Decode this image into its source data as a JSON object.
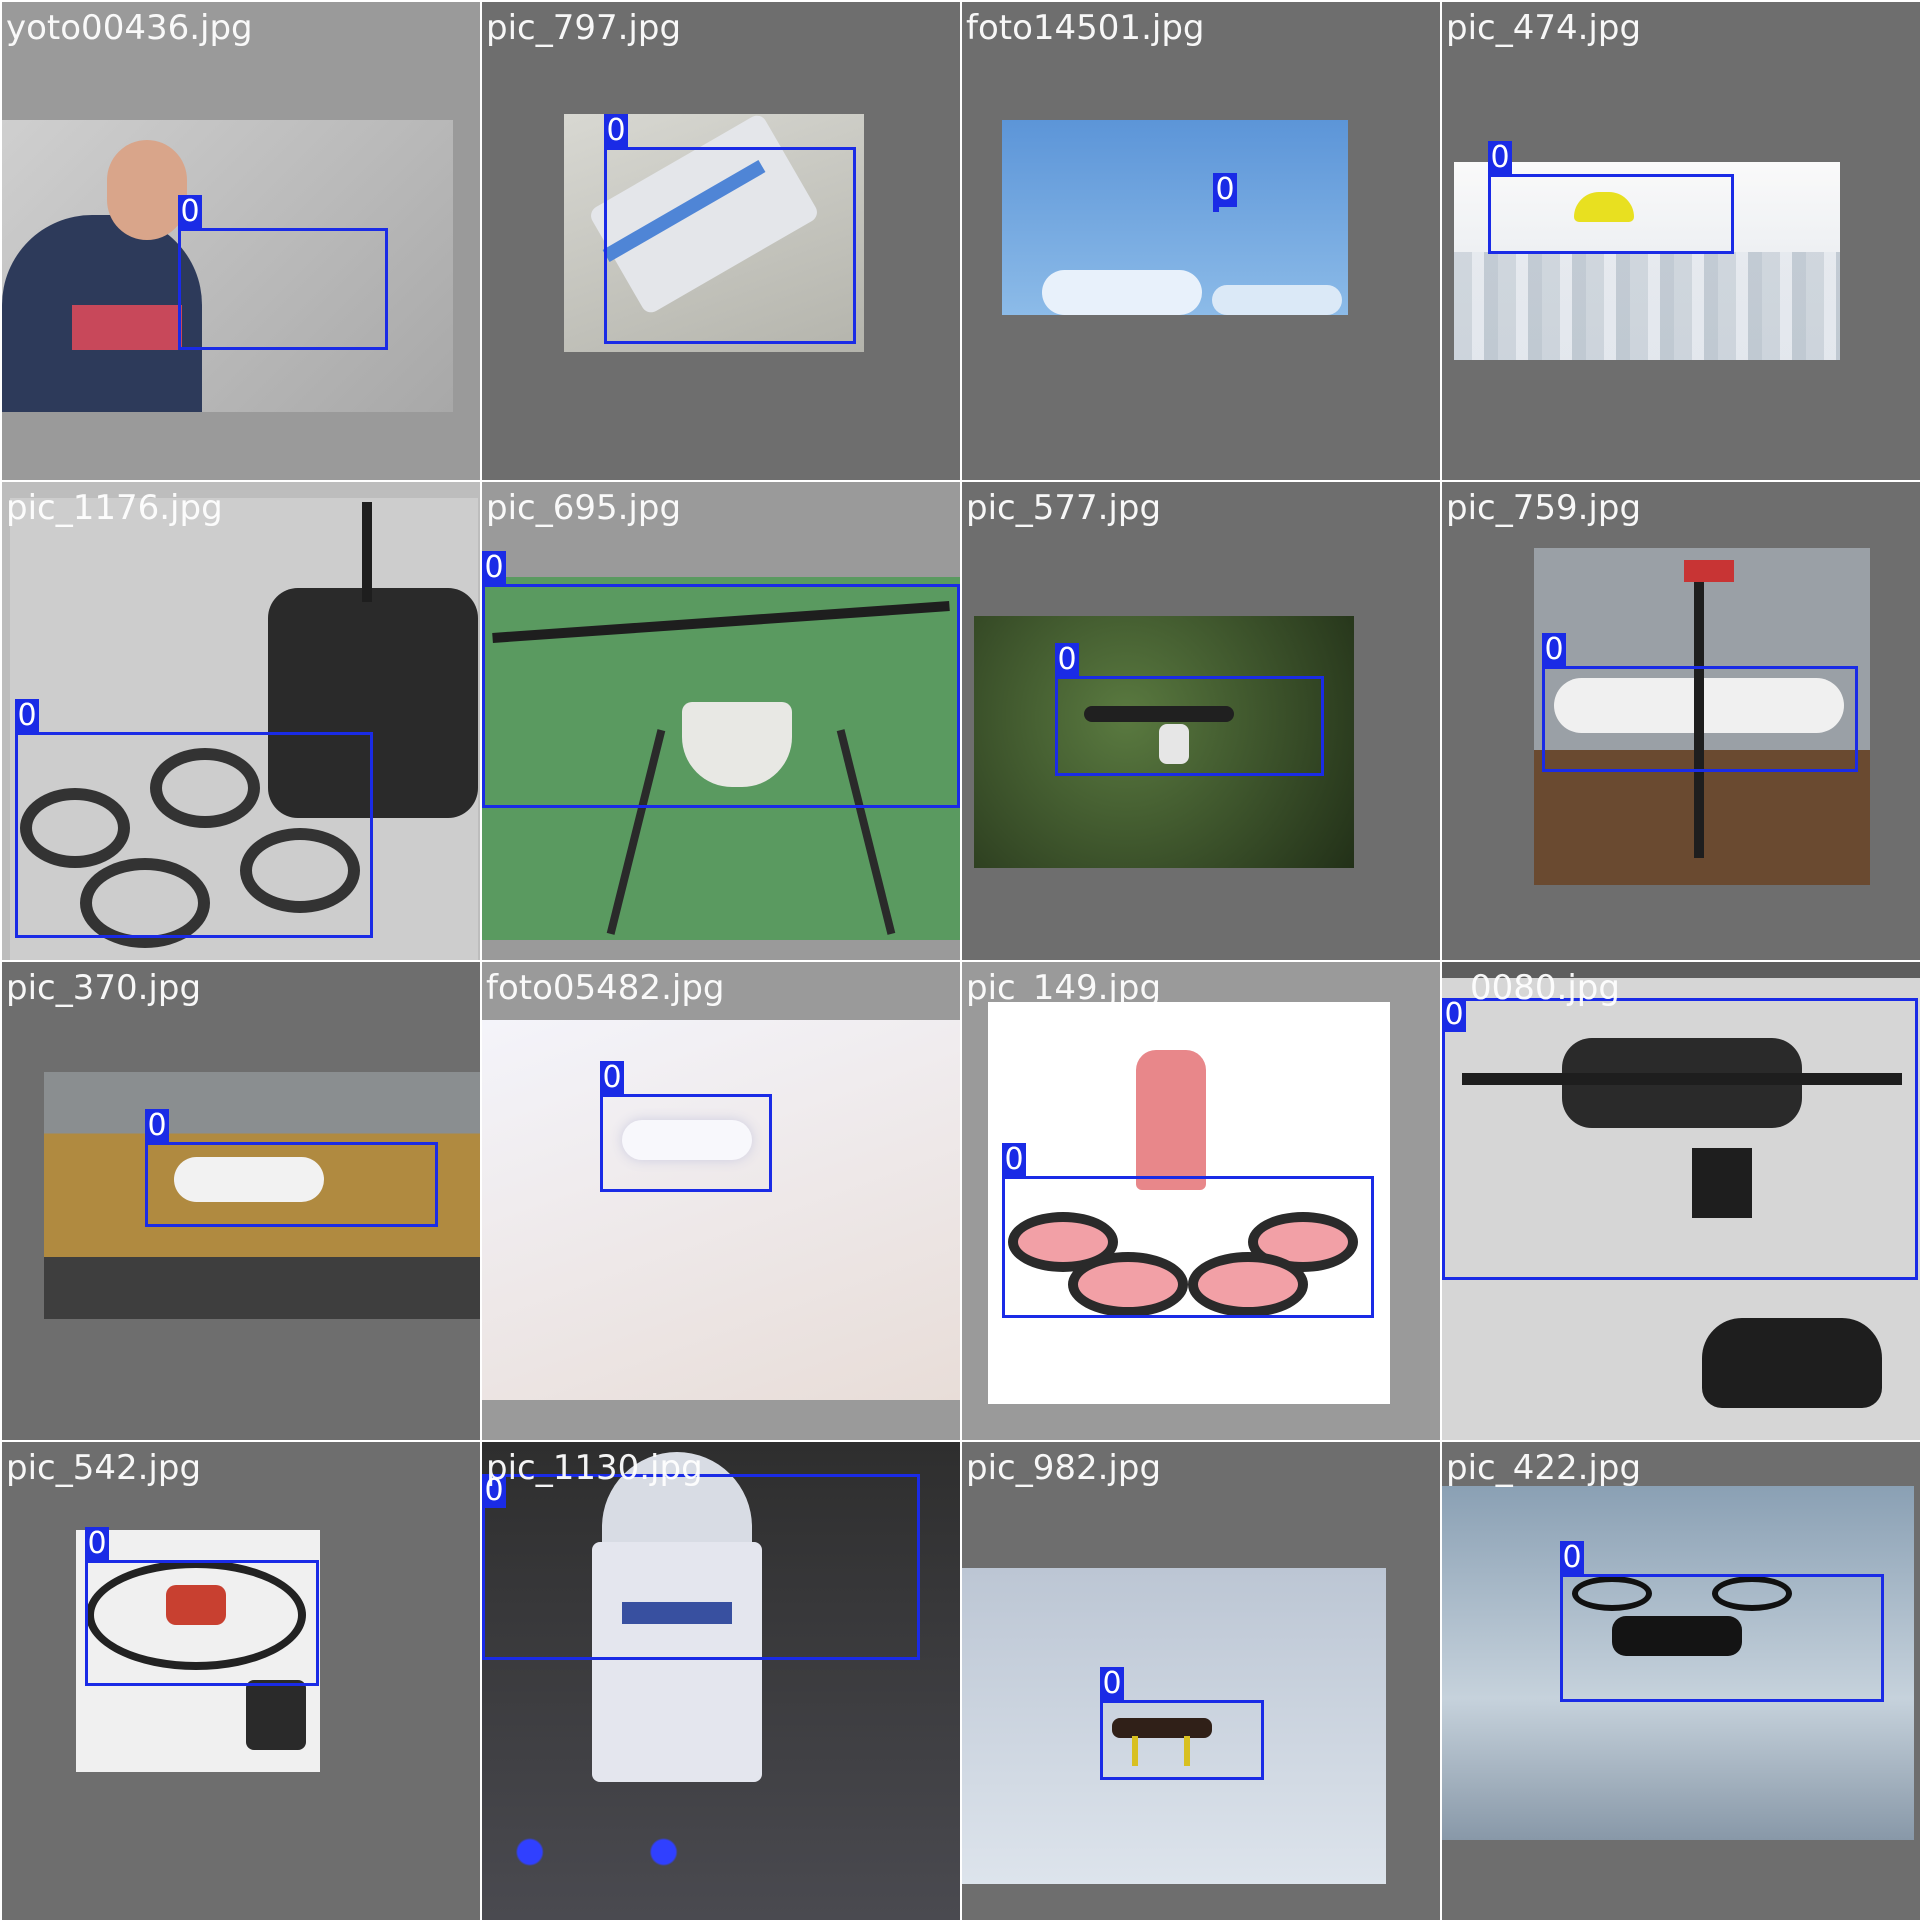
{
  "grid": {
    "cells": [
      {
        "filename": "yoto00436.jpg",
        "boxes": [
          {
            "label": "0"
          }
        ]
      },
      {
        "filename": "pic_797.jpg",
        "boxes": [
          {
            "label": "0"
          }
        ]
      },
      {
        "filename": "foto14501.jpg",
        "boxes": [
          {
            "label": "0"
          }
        ]
      },
      {
        "filename": "pic_474.jpg",
        "boxes": [
          {
            "label": "0"
          }
        ]
      },
      {
        "filename": "pic_1176.jpg",
        "boxes": [
          {
            "label": "0"
          }
        ]
      },
      {
        "filename": "pic_695.jpg",
        "boxes": [
          {
            "label": "0"
          }
        ]
      },
      {
        "filename": "pic_577.jpg",
        "boxes": [
          {
            "label": "0"
          }
        ]
      },
      {
        "filename": "pic_759.jpg",
        "boxes": [
          {
            "label": "0"
          }
        ]
      },
      {
        "filename": "pic_370.jpg",
        "boxes": [
          {
            "label": "0"
          }
        ]
      },
      {
        "filename": "foto05482.jpg",
        "boxes": [
          {
            "label": "0"
          }
        ]
      },
      {
        "filename": "pic_149.jpg",
        "boxes": [
          {
            "label": "0"
          }
        ]
      },
      {
        "filename": "0080.jpg",
        "boxes": [
          {
            "label": "0"
          }
        ]
      },
      {
        "filename": "pic_542.jpg",
        "boxes": [
          {
            "label": "0"
          }
        ]
      },
      {
        "filename": "pic_1130.jpg",
        "boxes": [
          {
            "label": "0"
          }
        ]
      },
      {
        "filename": "pic_982.jpg",
        "boxes": [
          {
            "label": "0"
          }
        ]
      },
      {
        "filename": "pic_422.jpg",
        "boxes": [
          {
            "label": "0"
          }
        ]
      }
    ]
  },
  "colors": {
    "box": "#1a2be6",
    "label_text": "#ffffff",
    "filename_text": "#ffffff"
  }
}
